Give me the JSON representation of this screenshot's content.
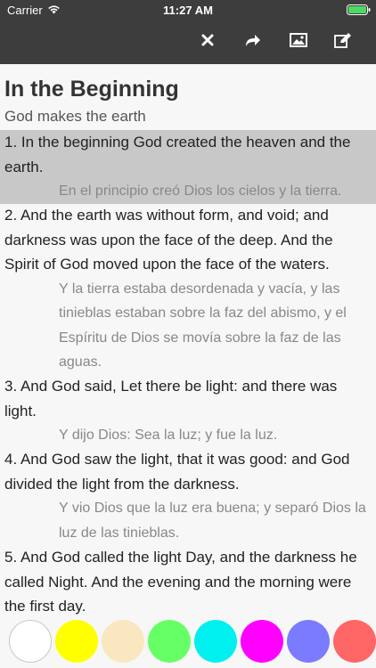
{
  "status_bar": {
    "carrier": "Carrier",
    "time": "11:27 AM"
  },
  "toolbar": {
    "icons": [
      "close-icon",
      "share-icon",
      "image-icon",
      "edit-icon"
    ]
  },
  "chapter": {
    "title": "In the Beginning",
    "subtitle": "God makes the earth",
    "verses": [
      {
        "en": "1. In the beginning God created the heaven and the earth.",
        "es": "En el principio creó Dios los cielos y la tierra.",
        "selected": true
      },
      {
        "en": "2. And the earth was without form, and void; and darkness was upon the face of the deep. And the Spirit of God moved upon the face of the waters.",
        "es": "Y la tierra estaba desordenada y vacía, y las tinieblas estaban sobre la faz del abismo, y el Espíritu de Dios se movía sobre la faz de las aguas.",
        "selected": false
      },
      {
        "en": "3. And God said, Let there be light: and there was light.",
        "es": "Y dijo Dios: Sea la luz; y fue la luz.",
        "selected": false
      },
      {
        "en": "4. And God saw the light, that it was good: and God divided the light from the darkness.",
        "es": "Y vio Dios que la luz era buena; y separó Dios la luz de las tinieblas.",
        "selected": false
      },
      {
        "en": "5. And God called the light Day, and the darkness he called Night. And the evening and the morning were the first day.",
        "es": "",
        "selected": false
      }
    ]
  },
  "highlight_palette": {
    "colors": [
      "#ffffff",
      "#ffff00",
      "#f9e8bf",
      "#66ff66",
      "#00f0f0",
      "#ff00ff",
      "#7b7bff",
      "#ff6666"
    ]
  }
}
